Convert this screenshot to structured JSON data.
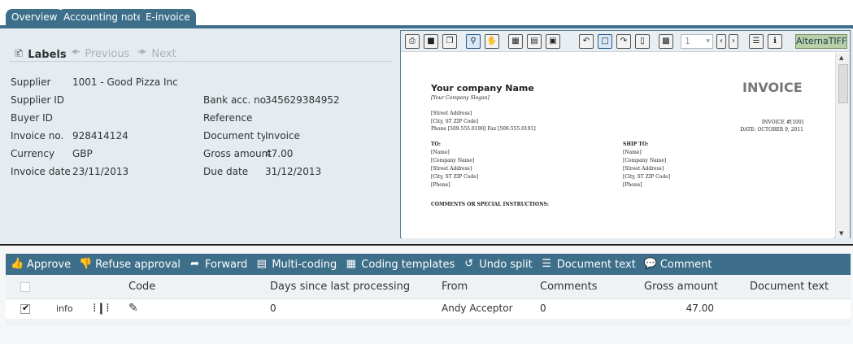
{
  "tabs": [
    "Overview",
    "Accounting note",
    "E-invoice"
  ],
  "labels_nav": {
    "labels": "Labels",
    "previous": "Previous",
    "next": "Next"
  },
  "fields": {
    "supplier_label": "Supplier",
    "supplier": "1001 - Good Pizza Inc",
    "supplier_id_label": "Supplier ID",
    "supplier_id": "",
    "buyer_id_label": "Buyer ID",
    "buyer_id": "",
    "invoice_no_label": "Invoice no.",
    "invoice_no": "928414124",
    "currency_label": "Currency",
    "currency": "GBP",
    "invoice_date_label": "Invoice date",
    "invoice_date": "23/11/2013",
    "bank_label": "Bank acc. no.",
    "bank": "345629384952",
    "reference_label": "Reference",
    "reference": "",
    "doctype_label": "Document typ",
    "doctype": "Invoice",
    "gross_label": "Gross amount",
    "gross": "47.00",
    "due_label": "Due date",
    "due": "31/12/2013"
  },
  "viewer": {
    "page_select": "1",
    "brand": "AlternaTIFF",
    "invoice": {
      "company": "Your company Name",
      "slogan": "[Your Company Slogan]",
      "title": "INVOICE",
      "street": "[Street Address]",
      "city": "[City, ST  ZIP Code]",
      "phone": "Phone [509.555.0190]   Fax [509.555.0191]",
      "invoice_no": "INVOICE #[100]",
      "date": "DATE: OCTOBER 9, 2011",
      "to_label": "TO:",
      "shipto_label": "SHIP TO:",
      "to_lines": [
        "[Name]",
        "[Company Name]",
        "[Street Address]",
        "[City, ST  ZIP Code]",
        "[Phone]"
      ],
      "ship_lines": [
        "[Name]",
        "[Company Name]",
        "[Street Address]",
        "[City, ST  ZIP Code]",
        "[Phone]"
      ],
      "comments": "COMMENTS OR SPECIAL INSTRUCTIONS:"
    }
  },
  "actions": [
    "Approve",
    "Refuse approval",
    "Forward",
    "Multi-coding",
    "Coding templates",
    "Undo split",
    "Document text",
    "Comment"
  ],
  "grid": {
    "headers": {
      "code": "Code",
      "days": "Days since last processing",
      "from": "From",
      "comments": "Comments",
      "gross": "Gross amount",
      "doctext": "Document text"
    },
    "row": {
      "info": "info",
      "days": "0",
      "from": "Andy Acceptor",
      "comments": "0",
      "gross": "47.00",
      "doctext": ""
    }
  }
}
